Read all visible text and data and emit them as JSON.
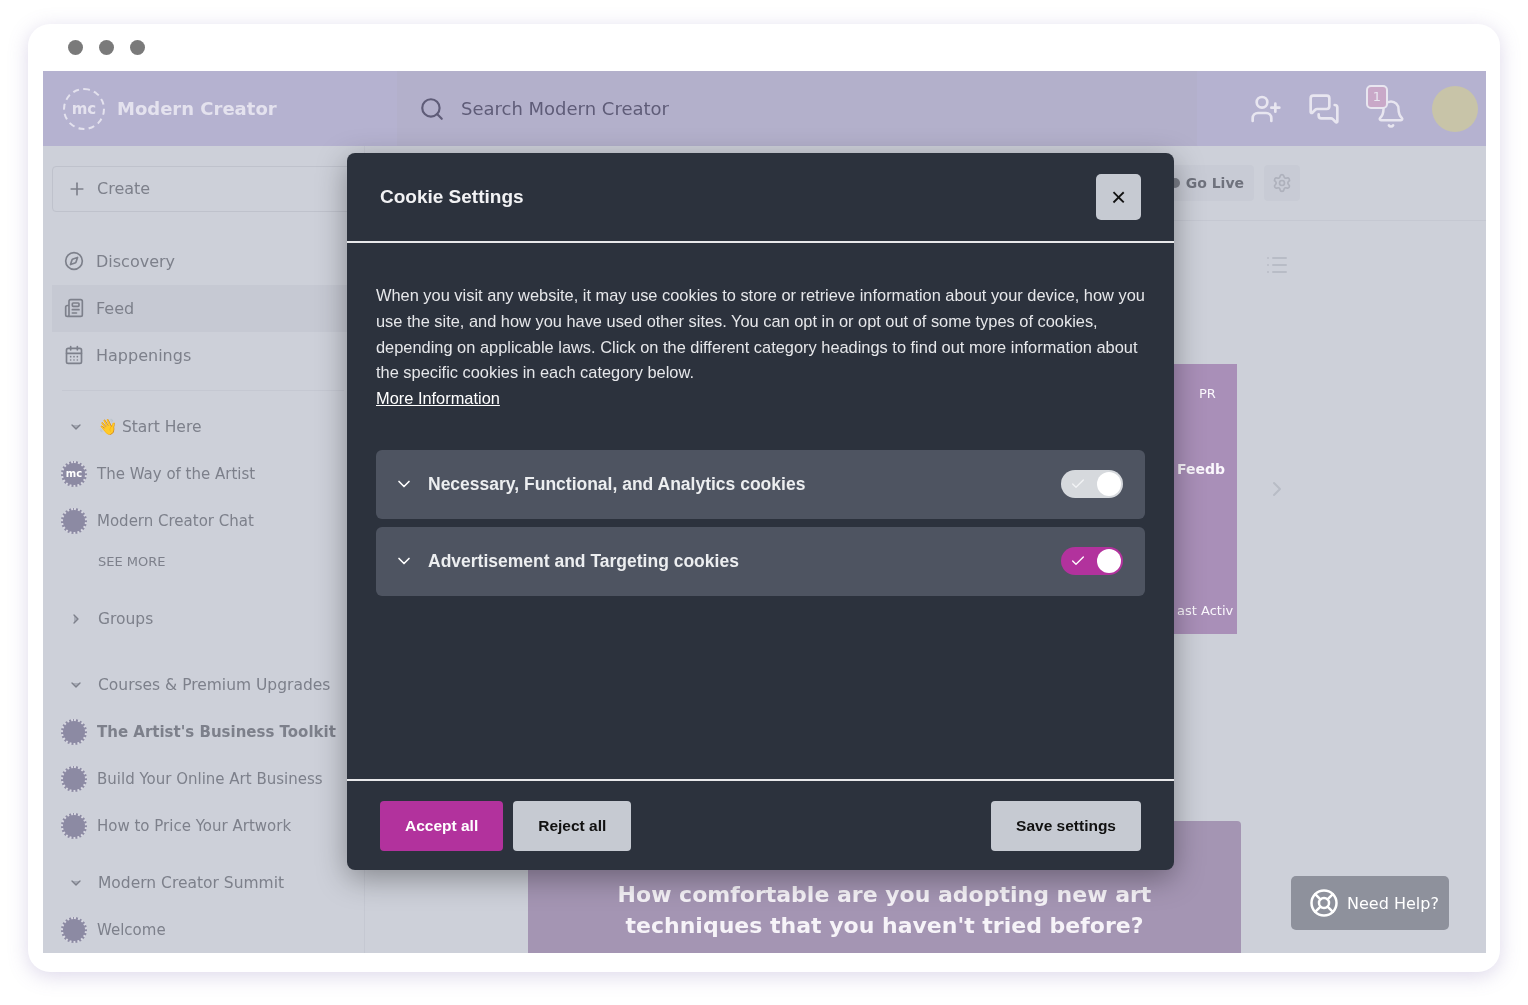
{
  "app": {
    "brand": {
      "logo": "mc",
      "name": "Modern Creator"
    },
    "search": {
      "placeholder": "Search Modern Creator"
    },
    "notifications": {
      "count": "1"
    }
  },
  "sidebar": {
    "create": "Create",
    "nav": [
      {
        "label": "Discovery",
        "selected": false
      },
      {
        "label": "Feed",
        "selected": true
      },
      {
        "label": "Happenings",
        "selected": false
      }
    ],
    "sections": [
      {
        "title": "👋 Start Here",
        "expanded": true,
        "items": [
          {
            "label": "The Way of the Artist",
            "selected": false,
            "logo": "mc"
          },
          {
            "label": "Modern Creator Chat",
            "selected": false
          }
        ],
        "more": "SEE MORE"
      },
      {
        "title": "Groups",
        "expanded": false
      },
      {
        "title": "Courses & Premium Upgrades",
        "expanded": true,
        "items": [
          {
            "label": "The Artist's Business Toolkit",
            "selected": true
          },
          {
            "label": "Build Your Online Art Business",
            "selected": false
          },
          {
            "label": "How to Price Your Artwork",
            "selected": false
          }
        ]
      },
      {
        "title": "Modern Creator Summit",
        "expanded": true,
        "items": [
          {
            "label": "Welcome",
            "selected": false
          }
        ]
      }
    ]
  },
  "main": {
    "go_live": "Go Live",
    "card": {
      "tag": "PR",
      "title": "Feedb",
      "footer": "ast Activ"
    },
    "question": "How comfortable are you adopting new art techniques that you haven't tried before?",
    "help": "Need Help?"
  },
  "dialog": {
    "title": "Cookie Settings",
    "close": "×",
    "text": "When you visit any website, it may use cookies to store or retrieve information about your device, how you use the site, and how you have used other sites. You can opt in or opt out of some types of cookies, depending on applicable laws. Click on the different category headings to find out more information about the specific cookies in each category below.",
    "link": "More Information",
    "categories": [
      {
        "label": "Necessary, Functional, and Analytics cookies",
        "expanded": false,
        "checked": true,
        "disabled": true
      },
      {
        "label": "Advertisement and Targeting cookies",
        "expanded": false,
        "checked": true,
        "disabled": false
      }
    ],
    "buttons": [
      {
        "label": "Accept all",
        "kind": "primary"
      },
      {
        "label": "Reject all",
        "kind": "secondary"
      },
      {
        "label": "Save settings",
        "kind": "secondary"
      }
    ]
  }
}
